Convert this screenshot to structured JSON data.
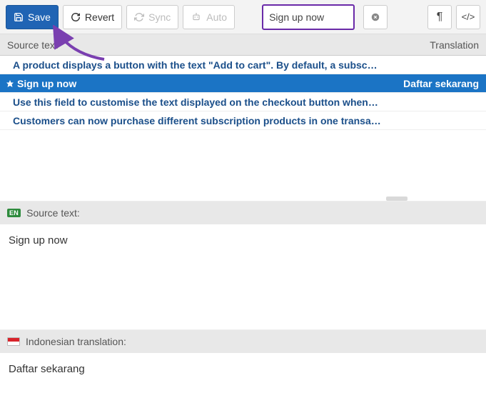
{
  "toolbar": {
    "save": "Save",
    "revert": "Revert",
    "sync": "Sync",
    "auto": "Auto",
    "search_value": "Sign up now"
  },
  "columns": {
    "source": "Source text",
    "translation": "Translation"
  },
  "rows": [
    {
      "source": "A product displays a button with the text \"Add to cart\". By default, a subsc…",
      "translation": "",
      "selected": false
    },
    {
      "source": "Sign up now",
      "translation": "Daftar sekarang",
      "selected": true
    },
    {
      "source": "Use this field to customise the text displayed on the checkout button when…",
      "translation": "",
      "selected": false
    },
    {
      "source": "Customers can now purchase different subscription products in one transa…",
      "translation": "",
      "selected": false
    }
  ],
  "source_panel": {
    "badge": "EN",
    "label": "Source text:",
    "value": "Sign up now"
  },
  "translation_panel": {
    "label": "Indonesian translation:",
    "value": "Daftar sekarang"
  }
}
